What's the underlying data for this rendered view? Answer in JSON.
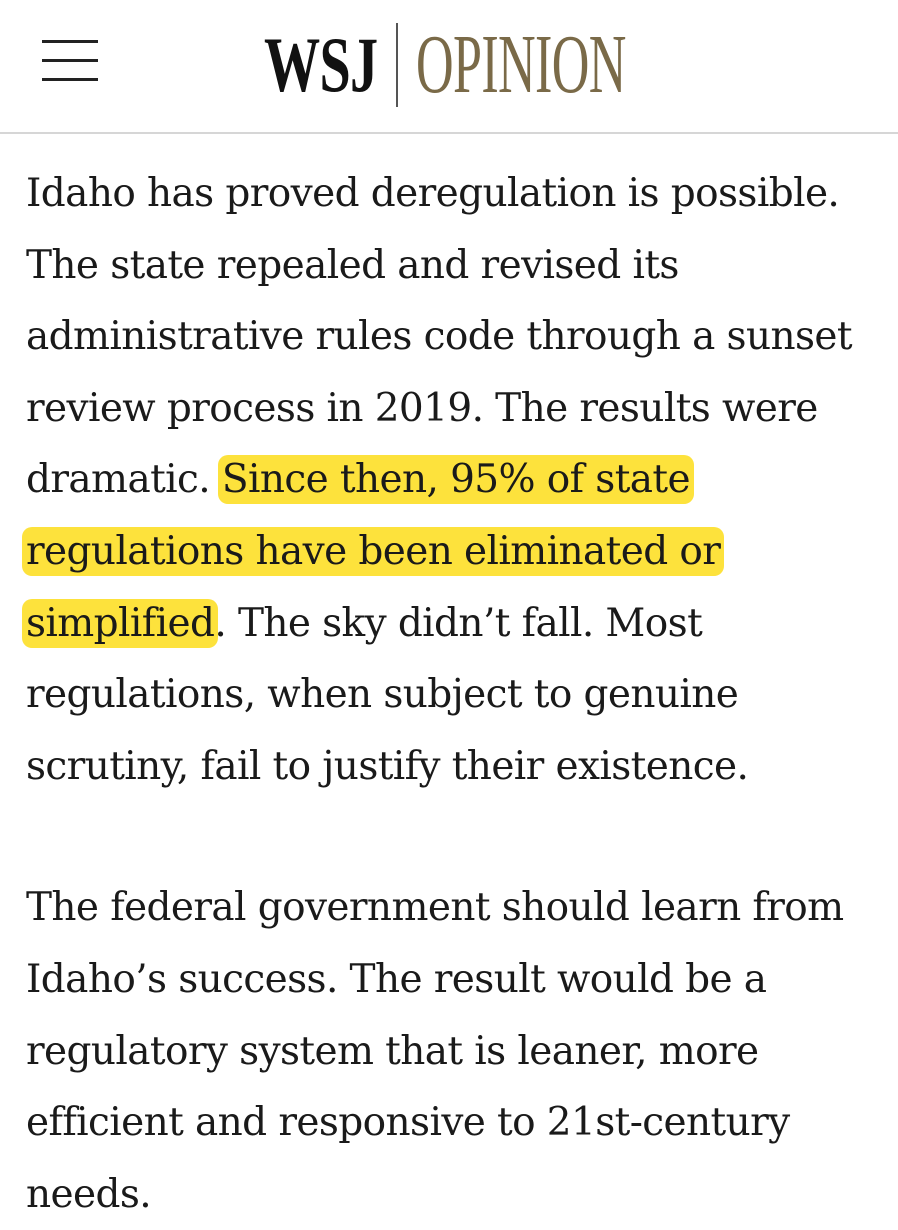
{
  "header": {
    "logo_wsj": "WSJ",
    "logo_section": "OPINION",
    "menu_icon": "hamburger-menu-icon"
  },
  "colors": {
    "section_accent": "#7a6a48",
    "highlight": "#fde23c",
    "text": "#1a1a1a",
    "divider": "#d6d6d6"
  },
  "article": {
    "p1_before": "Idaho has proved deregulation is possible. The state repealed and revised its administrative rules code through a sunset review process in 2019. The results were dramatic. ",
    "p1_highlight": "Since then, 95% of state regulations have been eliminated or simplified",
    "p1_after": ". The sky didn’t fall. Most regulations, when subject to genuine scrutiny, fail to justify their existence.",
    "p2": "The federal government should learn from Idaho’s success. The result would be a regulatory system that is leaner, more efficient and responsive to 21st-century needs."
  }
}
